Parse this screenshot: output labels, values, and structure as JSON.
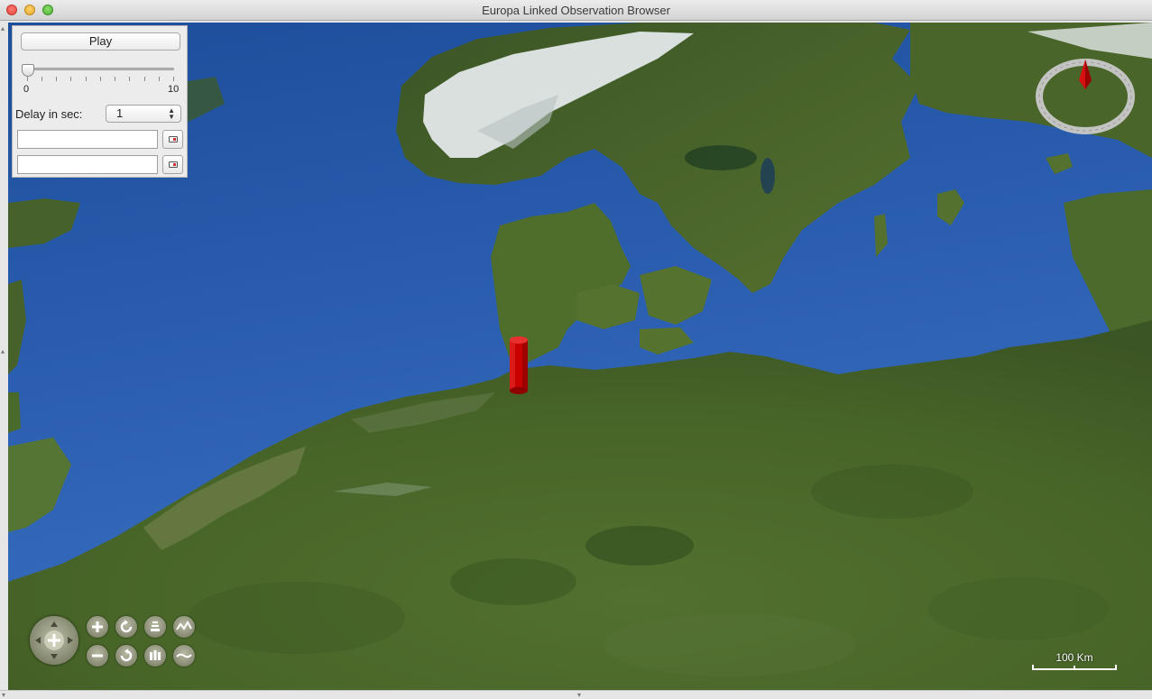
{
  "window": {
    "title": "Europa Linked Observation Browser"
  },
  "panel": {
    "play_label": "Play",
    "slider": {
      "min_label": "0",
      "max_label": "10",
      "value": 0
    },
    "delay_label": "Delay in sec:",
    "delay_value": "1",
    "field1_value": "",
    "field2_value": ""
  },
  "map": {
    "scale_label": "100 Km",
    "marker": "red-cylinder",
    "compass": "compass-icon"
  },
  "colors": {
    "ocean": "#2f63b4",
    "land": "#4f6a2e",
    "marker": "#d20000",
    "snow": "#e8eef0"
  }
}
